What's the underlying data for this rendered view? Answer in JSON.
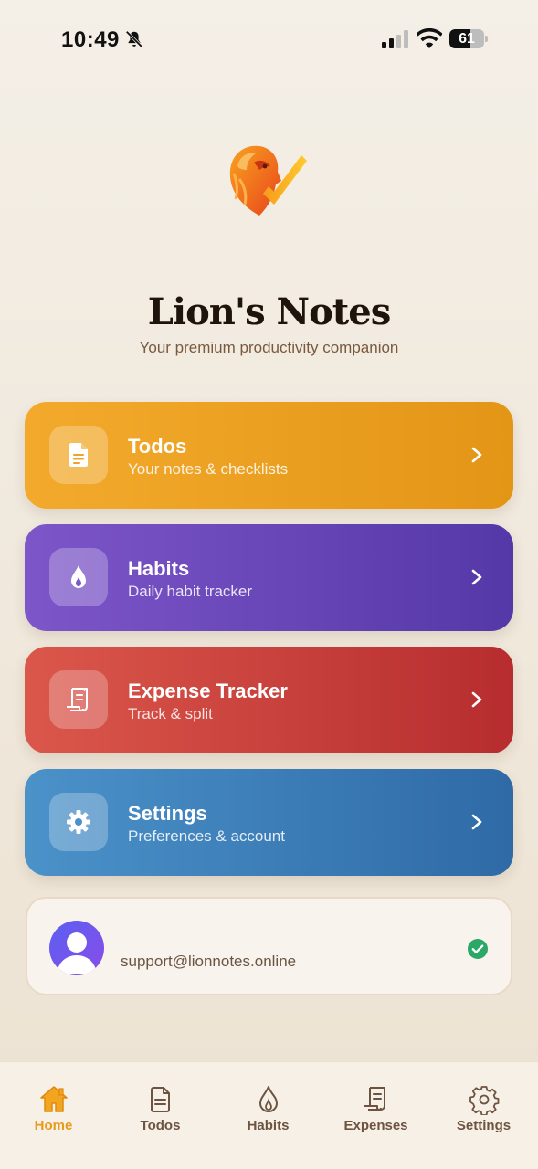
{
  "status_bar": {
    "time": "10:49",
    "battery_level": "61",
    "battery_fraction": 0.61
  },
  "header": {
    "logo_icon": "lion-check-logo",
    "title": "Lion's Notes",
    "subtitle": "Your premium productivity companion"
  },
  "cards": [
    {
      "title": "Todos",
      "subtitle": "Your notes & checklists",
      "icon": "document-icon",
      "color": "#f3aa2c"
    },
    {
      "title": "Habits",
      "subtitle": "Daily habit tracker",
      "icon": "flame-icon",
      "color": "#7d56c9"
    },
    {
      "title": "Expense Tracker",
      "subtitle": "Track & split",
      "icon": "receipt-icon",
      "color": "#db574b"
    },
    {
      "title": "Settings",
      "subtitle": "Preferences & account",
      "icon": "gear-icon",
      "color": "#4b92c9"
    }
  ],
  "account": {
    "email": "support@lionnotes.online",
    "verified_icon": "check-circle-icon",
    "verified_color": "#2aa867"
  },
  "tab_bar": {
    "active": "Home",
    "active_color": "#e99a1a",
    "tabs": [
      {
        "label": "Home",
        "icon": "home-icon"
      },
      {
        "label": "Todos",
        "icon": "document-icon"
      },
      {
        "label": "Habits",
        "icon": "flame-icon"
      },
      {
        "label": "Expenses",
        "icon": "receipt-icon"
      },
      {
        "label": "Settings",
        "icon": "gear-icon"
      }
    ]
  }
}
